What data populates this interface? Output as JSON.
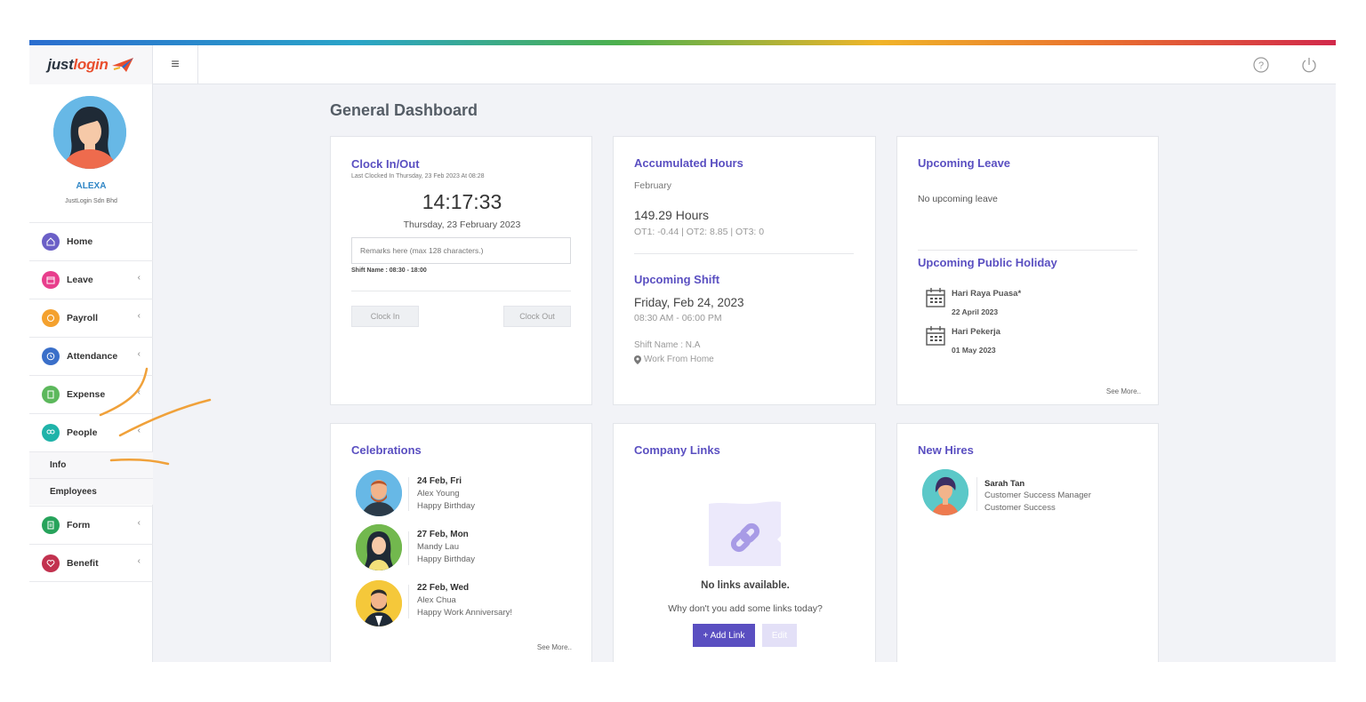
{
  "app": {
    "logo_prefix": "just",
    "logo_suffix": "login"
  },
  "user": {
    "name": "ALEXA",
    "company": "JustLogin Sdn Bhd"
  },
  "sidebar": {
    "items": [
      {
        "label": "Home",
        "color": "#6b5fc7"
      },
      {
        "label": "Leave",
        "color": "#e83e8c"
      },
      {
        "label": "Payroll",
        "color": "#f4a12e"
      },
      {
        "label": "Attendance",
        "color": "#3a6fc9"
      },
      {
        "label": "Expense",
        "color": "#5cb85c"
      },
      {
        "label": "People",
        "color": "#1fb3a9"
      },
      {
        "label": "Form",
        "color": "#27a35b"
      },
      {
        "label": "Benefit",
        "color": "#c2324f"
      }
    ],
    "sub_items": [
      "Info",
      "Employees"
    ],
    "chevron": "‹"
  },
  "topbar": {
    "menu_icon": "≡"
  },
  "page": {
    "title": "General Dashboard"
  },
  "clock": {
    "title": "Clock In/Out",
    "last_clocked": "Last Clocked In Thursday, 23 Feb 2023 At 08:28",
    "time": "14:17:33",
    "date": "Thursday, 23 February 2023",
    "remarks_placeholder": "Remarks here (max 128 characters.)",
    "shift_name": "Shift Name : 08:30 - 18:00",
    "clock_in": "Clock In",
    "clock_out": "Clock Out"
  },
  "hours": {
    "title": "Accumulated Hours",
    "month": "February",
    "total": "149.29 Hours",
    "ot": "OT1: -0.44 | OT2: 8.85 | OT3: 0"
  },
  "shift": {
    "title": "Upcoming Shift",
    "date": "Friday, Feb 24, 2023",
    "time": "08:30 AM - 06:00 PM",
    "shift_name": "Shift Name : N.A",
    "location": "Work From Home"
  },
  "leave": {
    "title": "Upcoming Leave",
    "empty": "No upcoming leave"
  },
  "holiday": {
    "title": "Upcoming Public Holiday",
    "items": [
      {
        "name": "Hari Raya Puasa*",
        "date": "22 April 2023"
      },
      {
        "name": "Hari Pekerja",
        "date": "01 May 2023"
      }
    ],
    "see_more": "See More.."
  },
  "celebrations": {
    "title": "Celebrations",
    "items": [
      {
        "date": "24 Feb, Fri",
        "name": "Alex Young",
        "event": "Happy Birthday"
      },
      {
        "date": "27 Feb, Mon",
        "name": "Mandy Lau",
        "event": "Happy Birthday"
      },
      {
        "date": "22 Feb, Wed",
        "name": "Alex Chua",
        "event": "Happy Work Anniversary!"
      }
    ],
    "see_more": "See More.."
  },
  "links": {
    "title": "Company Links",
    "empty_title": "No links available.",
    "empty_sub": "Why don't you add some links today?",
    "add": "+ Add Link",
    "edit": "Edit"
  },
  "hires": {
    "title": "New Hires",
    "items": [
      {
        "name": "Sarah Tan",
        "role": "Customer Success Manager",
        "dept": "Customer Success"
      }
    ]
  }
}
